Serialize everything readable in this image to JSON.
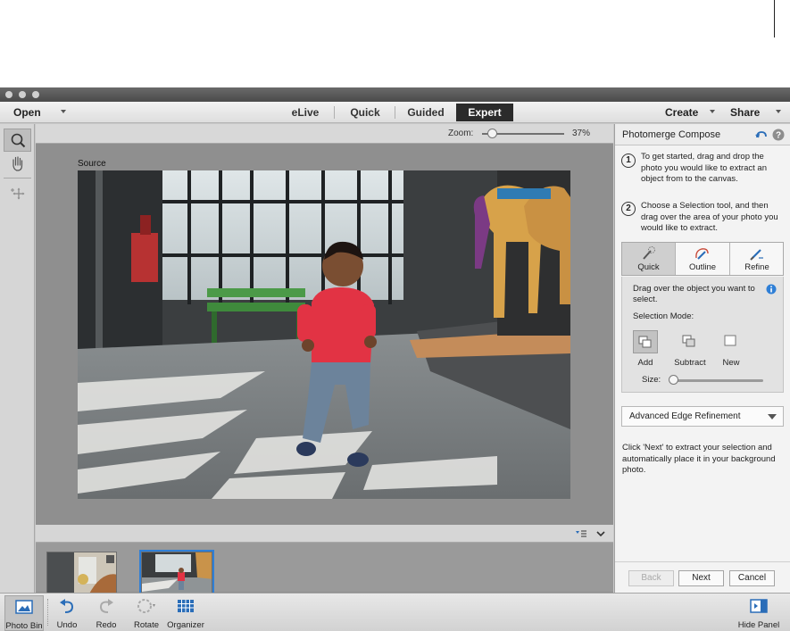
{
  "menubar": {
    "open_label": "Open",
    "modes": [
      {
        "label": "eLive"
      },
      {
        "label": "Quick"
      },
      {
        "label": "Guided"
      },
      {
        "label": "Expert",
        "active": true
      }
    ],
    "create_label": "Create",
    "share_label": "Share"
  },
  "tools": [
    {
      "icon": "zoom-icon",
      "selected": true
    },
    {
      "icon": "hand-icon",
      "selected": false
    },
    {
      "icon": "move-icon",
      "selected": false
    }
  ],
  "canvas": {
    "zoom_label": "Zoom:",
    "zoom_value": "37%",
    "zoom_level_percent": 37,
    "source_label": "Source"
  },
  "panel": {
    "title": "Photomerge Compose",
    "steps": [
      {
        "number": "1",
        "text": "To get started, drag and drop the photo you would like to extract an object from to the canvas."
      },
      {
        "number": "2",
        "text": "Choose a Selection tool, and then drag over the area of your photo you would like to extract."
      }
    ],
    "selection_tools": [
      {
        "label": "Quick",
        "icon": "quick-selection-icon",
        "active": true
      },
      {
        "label": "Outline",
        "icon": "outline-selection-icon",
        "active": false
      },
      {
        "label": "Refine",
        "icon": "refine-brush-icon",
        "active": false
      }
    ],
    "instruction": "Drag over the object you want to select.",
    "selection_mode_label": "Selection Mode:",
    "selection_modes": [
      {
        "label": "Add",
        "active": true
      },
      {
        "label": "Subtract",
        "active": false
      },
      {
        "label": "New",
        "active": false
      }
    ],
    "size_label": "Size:",
    "advanced_label": "Advanced Edge Refinement",
    "next_hint": "Click 'Next' to extract your selection and automatically place it in your background photo.",
    "buttons": {
      "back": "Back",
      "next": "Next",
      "cancel": "Cancel"
    }
  },
  "taskbar": {
    "photo_bin": "Photo Bin",
    "undo": "Undo",
    "redo": "Redo",
    "rotate": "Rotate",
    "organizer": "Organizer",
    "hide_panel": "Hide Panel"
  },
  "colors": {
    "active_tab_bg": "#2b2b2b",
    "selection_blue": "#2f7fd6",
    "icon_blue": "#2a6db8"
  }
}
